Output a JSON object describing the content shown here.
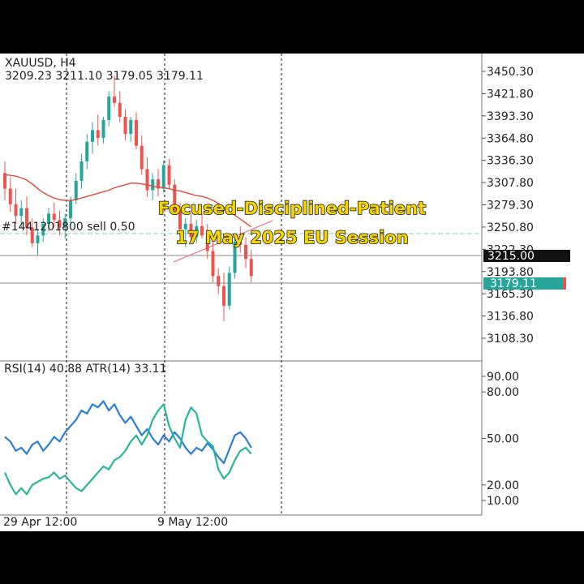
{
  "symbol_line": "XAUUSD, H4",
  "ohlc_line": "3209.23 3211.10 3179.05 3179.11",
  "order_line": "#1441201800 sell 0.50",
  "banner": {
    "line1": "Focused-Disciplined-Patient",
    "line2": "17 May 2025 EU Session",
    "color": "#f3d400"
  },
  "price_axis": {
    "ticks": [
      "3450.30",
      "3421.80",
      "3393.30",
      "3364.80",
      "3336.30",
      "3307.80",
      "3279.30",
      "3250.80",
      "3222.30",
      "3193.80",
      "3165.30",
      "3136.80",
      "3108.30"
    ],
    "tick_values": [
      3450.3,
      3421.8,
      3393.3,
      3364.8,
      3336.3,
      3307.8,
      3279.3,
      3250.8,
      3222.3,
      3193.8,
      3165.3,
      3136.8,
      3108.3
    ],
    "order_price_label": "3215.00",
    "current_price_label": "3179.11",
    "current_price_color": "#26a69a"
  },
  "indicator": {
    "label": "RSI(14) 40.88 ATR(14) 33.11",
    "ticks": [
      "90.00",
      "80.00",
      "50.00",
      "20.00",
      "10.00"
    ],
    "tick_values": [
      90,
      80,
      50,
      20,
      10
    ]
  },
  "time_axis": {
    "labels": [
      "29 Apr 12:00",
      "9 May 12:00"
    ]
  },
  "chart_data": [
    {
      "type": "candlestick",
      "title": "XAUUSD, H4",
      "ylim": [
        3095,
        3470
      ],
      "ma_color": "#e04a3a",
      "up_color": "#26a69a",
      "down_color": "#ef5350",
      "series": [
        {
          "name": "price",
          "ohlc": [
            [
              3320,
              3335,
              3285,
              3300
            ],
            [
              3300,
              3315,
              3270,
              3280
            ],
            [
              3280,
              3300,
              3255,
              3265
            ],
            [
              3265,
              3285,
              3250,
              3275
            ],
            [
              3275,
              3290,
              3240,
              3250
            ],
            [
              3250,
              3262,
              3225,
              3230
            ],
            [
              3230,
              3248,
              3215,
              3240
            ],
            [
              3240,
              3262,
              3232,
              3255
            ],
            [
              3255,
              3275,
              3245,
              3268
            ],
            [
              3268,
              3282,
              3250,
              3260
            ],
            [
              3260,
              3272,
              3240,
              3250
            ],
            [
              3250,
              3268,
              3236,
              3262
            ],
            [
              3262,
              3290,
              3255,
              3285
            ],
            [
              3285,
              3320,
              3280,
              3310
            ],
            [
              3310,
              3345,
              3300,
              3335
            ],
            [
              3335,
              3370,
              3325,
              3360
            ],
            [
              3360,
              3385,
              3345,
              3375
            ],
            [
              3375,
              3395,
              3355,
              3365
            ],
            [
              3365,
              3392,
              3358,
              3388
            ],
            [
              3388,
              3425,
              3380,
              3418
            ],
            [
              3418,
              3445,
              3405,
              3410
            ],
            [
              3410,
              3425,
              3385,
              3392
            ],
            [
              3392,
              3402,
              3362,
              3370
            ],
            [
              3370,
              3392,
              3360,
              3388
            ],
            [
              3388,
              3398,
              3350,
              3355
            ],
            [
              3355,
              3368,
              3318,
              3325
            ],
            [
              3325,
              3340,
              3290,
              3298
            ],
            [
              3298,
              3320,
              3285,
              3312
            ],
            [
              3312,
              3325,
              3290,
              3300
            ],
            [
              3300,
              3336,
              3295,
              3330
            ],
            [
              3330,
              3338,
              3300,
              3305
            ],
            [
              3305,
              3312,
              3268,
              3272
            ],
            [
              3272,
              3282,
              3240,
              3248
            ],
            [
              3248,
              3262,
              3225,
              3255
            ],
            [
              3255,
              3268,
              3232,
              3238
            ],
            [
              3238,
              3260,
              3230,
              3252
            ],
            [
              3252,
              3268,
              3236,
              3240
            ],
            [
              3240,
              3255,
              3210,
              3220
            ],
            [
              3220,
              3232,
              3180,
              3188
            ],
            [
              3188,
              3198,
              3165,
              3175
            ],
            [
              3175,
              3192,
              3130,
              3150
            ],
            [
              3150,
              3200,
              3145,
              3192
            ],
            [
              3192,
              3240,
              3185,
              3232
            ],
            [
              3232,
              3252,
              3218,
              3228
            ],
            [
              3228,
              3238,
              3198,
              3210
            ],
            [
              3210,
              3222,
              3180,
              3188
            ]
          ]
        },
        {
          "name": "MA",
          "values": [
            3318,
            3317,
            3316,
            3314,
            3311,
            3306,
            3300,
            3295,
            3291,
            3288,
            3286,
            3285,
            3285,
            3286,
            3288,
            3290,
            3292,
            3294,
            3296,
            3298,
            3301,
            3303,
            3305,
            3307,
            3307,
            3306,
            3305,
            3303,
            3302,
            3301,
            3300,
            3298,
            3297,
            3295,
            3293,
            3291,
            3290,
            3288,
            3285,
            3281,
            3276,
            3271,
            3266,
            3261,
            3256,
            3251
          ]
        }
      ],
      "levels": [
        3215.0,
        3179.11
      ]
    },
    {
      "type": "line",
      "title": "RSI(14) 40.88 ATR(14) 33.11",
      "ylim": [
        0,
        100
      ],
      "series": [
        {
          "name": "RSI(14)",
          "color": "#2a7fd4",
          "values": [
            51,
            48,
            42,
            44,
            40,
            46,
            48,
            42,
            46,
            51,
            48,
            54,
            58,
            62,
            68,
            66,
            72,
            70,
            74,
            68,
            72,
            65,
            60,
            64,
            58,
            52,
            56,
            50,
            46,
            52,
            48,
            54,
            50,
            44,
            40,
            44,
            42,
            47,
            43,
            38,
            34,
            43,
            52,
            54,
            50,
            44
          ]
        },
        {
          "name": "ATR(14)",
          "color": "#2ab49a",
          "values": [
            28,
            20,
            14,
            18,
            14,
            20,
            22,
            24,
            25,
            28,
            24,
            26,
            22,
            18,
            16,
            20,
            24,
            28,
            32,
            30,
            36,
            38,
            42,
            48,
            52,
            46,
            52,
            62,
            68,
            72,
            58,
            50,
            44,
            62,
            70,
            66,
            52,
            48,
            45,
            30,
            24,
            28,
            36,
            42,
            44,
            40
          ]
        }
      ]
    }
  ]
}
